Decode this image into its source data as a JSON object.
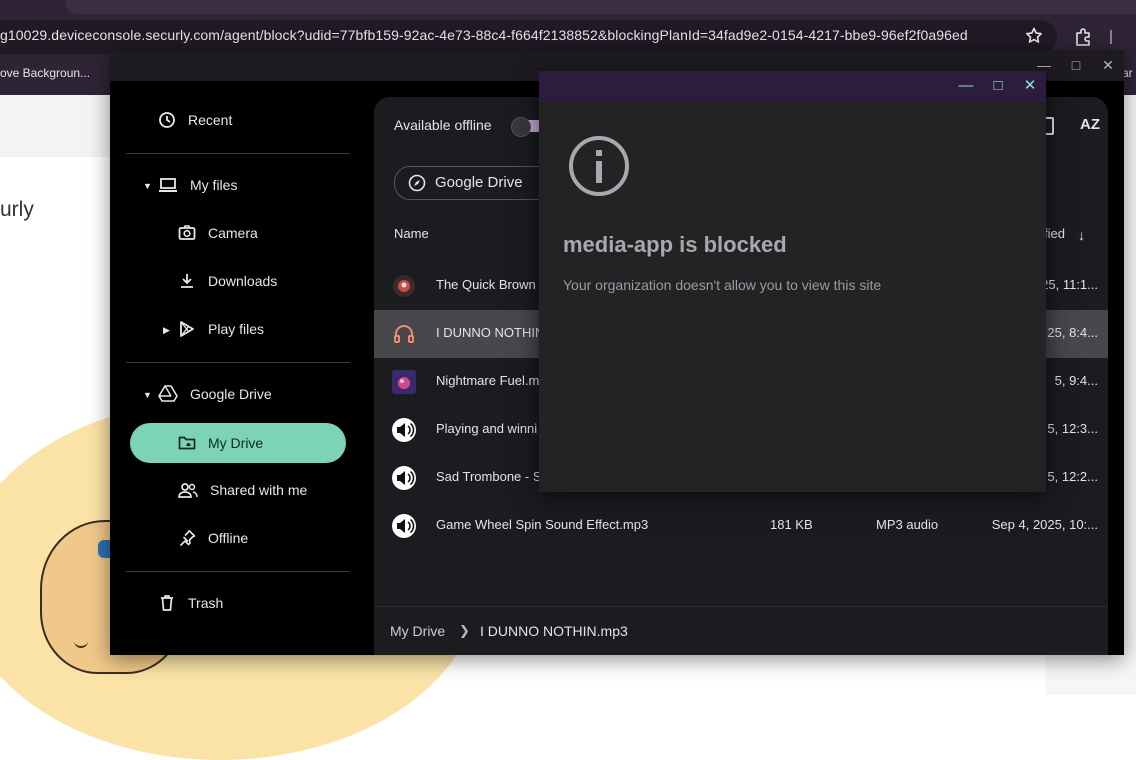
{
  "browser": {
    "url": "g10029.deviceconsole.securly.com/agent/block?udid=77bfb159-92ac-4e73-88c4-f664f2138852&blockingPlanId=34fad9e2-0154-4217-bbe9-96ef2f0a96ed",
    "bookmark_left": "ove Backgroun...",
    "bookmark_right": "ar"
  },
  "background_page": {
    "logo_text": "urly"
  },
  "files_window": {
    "sidebar": {
      "recent": "Recent",
      "my_files": "My files",
      "camera": "Camera",
      "downloads": "Downloads",
      "play_files": "Play files",
      "google_drive": "Google Drive",
      "my_drive": "My Drive",
      "shared_with_me": "Shared with me",
      "offline": "Offline",
      "trash": "Trash"
    },
    "toolbar": {
      "available_offline": "Available offline",
      "drive_chip": "Google Drive"
    },
    "columns": {
      "name": "Name",
      "modified": "fied"
    },
    "files": [
      {
        "name": "The Quick Brown",
        "size": "",
        "type": "",
        "date": "25, 11:1...",
        "icon": "thumbnail-icon",
        "selected": false
      },
      {
        "name": "I DUNNO NOTHIN",
        "size": "",
        "type": "",
        "date": "25, 8:4...",
        "icon": "headphones-icon",
        "selected": true
      },
      {
        "name": "Nightmare Fuel.m",
        "size": "",
        "type": "",
        "date": "5, 9:4...",
        "icon": "thumbnail-icon",
        "selected": false
      },
      {
        "name": "Playing and winni",
        "size": "",
        "type": "",
        "date": "5, 12:3...",
        "icon": "speaker-icon",
        "selected": false
      },
      {
        "name": "Sad Trombone - S",
        "size": "",
        "type": "",
        "date": "5, 12:2...",
        "icon": "speaker-icon",
        "selected": false
      },
      {
        "name": "Game Wheel Spin Sound Effect.mp3",
        "size": "181 KB",
        "type": "MP3 audio",
        "date": "Sep 4, 2025, 10:...",
        "icon": "speaker-icon",
        "selected": false
      }
    ],
    "breadcrumb": {
      "root": "My Drive",
      "current": "I DUNNO NOTHIN.mp3"
    }
  },
  "blocked_dialog": {
    "title": "media-app is blocked",
    "message": "Your organization doesn't allow you to view this site"
  },
  "colors": {
    "accent_active": "#7dd3b6",
    "dialog_titlebar": "#2d1d3d",
    "dialog_controls": "#8de3d3",
    "browser_frame": "#2f2436"
  }
}
